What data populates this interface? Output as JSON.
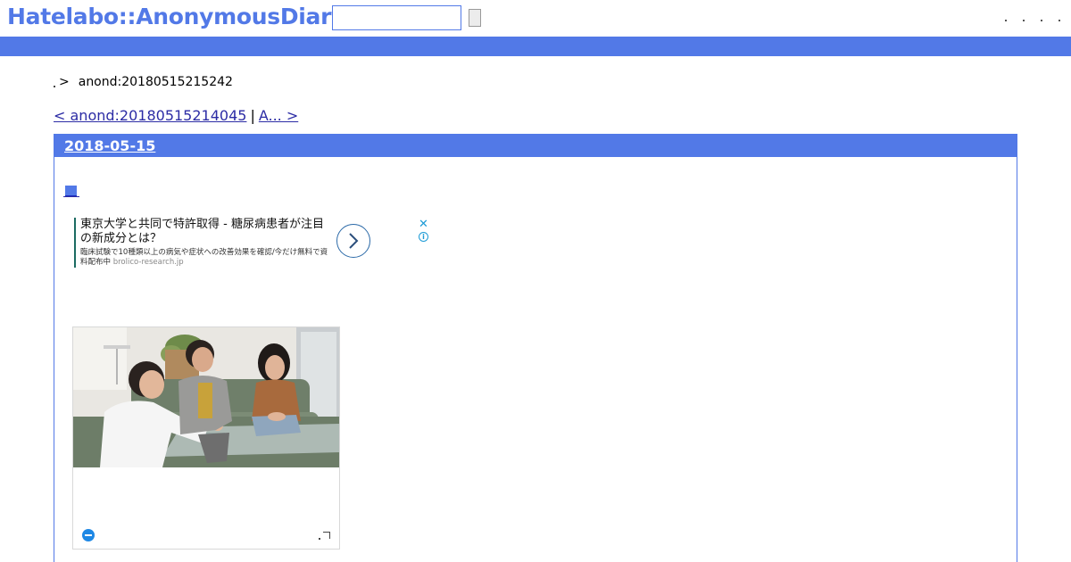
{
  "header": {
    "logo": "Hatelabo::AnonymousDiary",
    "search_value": "",
    "brand_color": "#5279e7"
  },
  "breadcrumb": {
    "separator": ">",
    "current": "anond:20180515215242"
  },
  "pager": {
    "prev_label": "< anond:20180515214045",
    "divider": "|",
    "next_label": "A... >"
  },
  "day": {
    "date": "2018-05-15",
    "entry_marker": "■"
  },
  "text_ad": {
    "headline": "東京大学と共同で特許取得 - 糖尿病患者が注目の新成分とは？",
    "description": "臨床試験で10種類以上の病気や症状への改善効果を確認/今だけ無料で資料配布中",
    "domain": "brolico-research.jp",
    "close_icon": "✕",
    "info_icon": "i"
  },
  "image_ad": {
    "photo_icon": "photo-of-four-people-meeting-on-sofa",
    "logo_icon": "ad-network-logo-icon",
    "corner_icon": "adchoices-corner-icon"
  }
}
